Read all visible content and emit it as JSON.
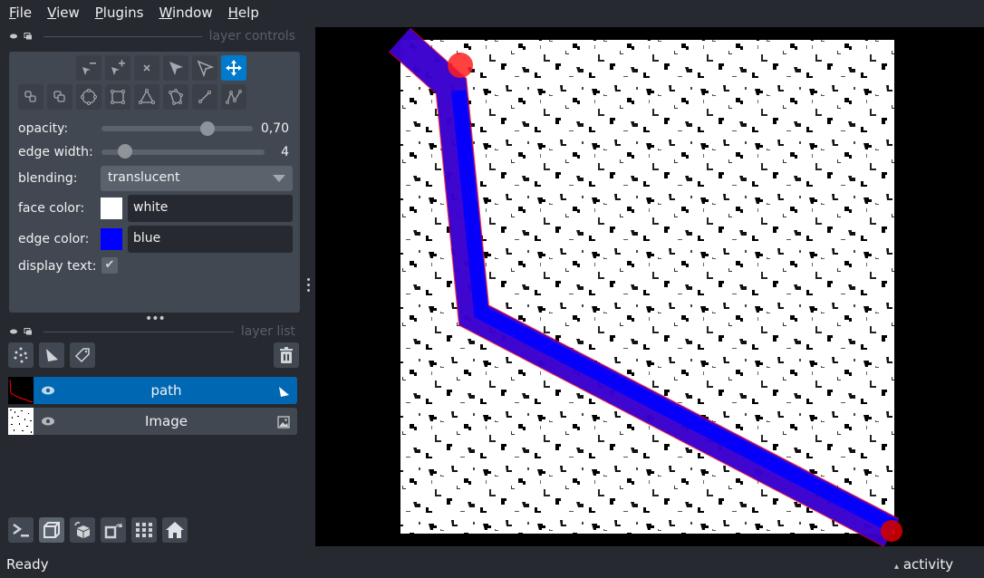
{
  "menu": [
    {
      "label": "File",
      "accel": "F",
      "rest": "ile"
    },
    {
      "label": "View",
      "accel": "V",
      "rest": "iew"
    },
    {
      "label": "Plugins",
      "accel": "P",
      "rest": "lugins"
    },
    {
      "label": "Window",
      "accel": "W",
      "rest": "indow"
    },
    {
      "label": "Help",
      "accel": "H",
      "rest": "elp"
    }
  ],
  "layer_controls": {
    "title": "layer controls",
    "tools_row1": [
      "remove-vertex",
      "insert-vertex",
      "delete-shape",
      "select-shapes",
      "select-vertices",
      "pan-zoom"
    ],
    "tools_row2": [
      "move-back",
      "move-front",
      "add-ellipse",
      "add-rectangle",
      "add-triangle",
      "add-polygon",
      "add-line",
      "add-path"
    ],
    "active_tool": "pan-zoom",
    "opacity": {
      "label": "opacity:",
      "value": 0.7,
      "display": "0,70"
    },
    "edge_width": {
      "label": "edge width:",
      "value": 4,
      "display": "4",
      "min": 0,
      "max": 40
    },
    "blending": {
      "label": "blending:",
      "value": "translucent"
    },
    "face_color": {
      "label": "face color:",
      "value": "white",
      "swatch": "#ffffff"
    },
    "edge_color": {
      "label": "edge color:",
      "value": "blue",
      "swatch": "#0000ff"
    },
    "display_text": {
      "label": "display text:",
      "checked": true,
      "glyph": "✔"
    }
  },
  "handle_dots": "•••",
  "layer_list": {
    "title": "layer list",
    "layers": [
      {
        "name": "path",
        "type": "shapes",
        "selected": true,
        "visible": true
      },
      {
        "name": "Image",
        "type": "image",
        "selected": false,
        "visible": true
      }
    ]
  },
  "status": {
    "text": "Ready",
    "activity": "activity",
    "activity_icon": "▴"
  },
  "colors": {
    "accent": "#007acc",
    "selected_layer": "#0068b3",
    "path_edge": "#0000ff",
    "path_highlight": "#ff0000"
  }
}
